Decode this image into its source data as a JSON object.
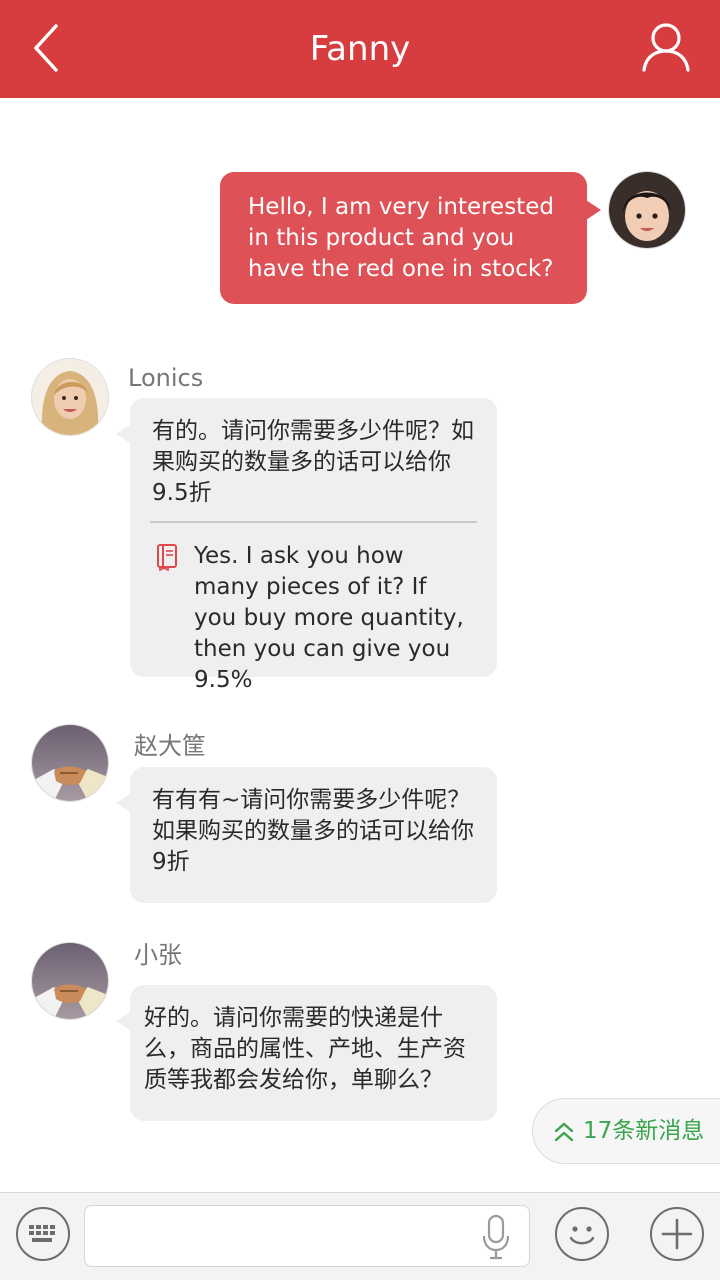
{
  "header": {
    "title": "Fanny",
    "back_icon": "back-arrow-icon",
    "user_icon": "user-profile-icon",
    "bg_color": "#d73c3f"
  },
  "messages": [
    {
      "direction": "outgoing",
      "text": "Hello, I am very interested in this product and you have the red one in stock?"
    },
    {
      "direction": "incoming",
      "sender": "Lonics",
      "text": "有的。请问你需要多少件呢？如果购买的数量多的话可以给你9.5折",
      "translation": "Yes. I ask you how many pieces of it? If you buy more quantity, then you can give you 9.5%",
      "translation_icon": "book-icon"
    },
    {
      "direction": "incoming",
      "sender": "赵大筐",
      "text": "有有有~请问你需要多少件呢？如果购买的数量多的话可以给你9折"
    },
    {
      "direction": "incoming",
      "sender": "小张",
      "text": "好的。请问你需要的快递是什么，商品的属性、产地、生产资质等我都会发给你，单聊么？"
    }
  ],
  "new_messages": {
    "label": "17条新消息",
    "icon": "double-chevron-up-icon",
    "color": "#3aa64b"
  },
  "toolbar": {
    "keyboard_icon": "keyboard-icon",
    "mic_icon": "microphone-icon",
    "emoji_icon": "smiley-icon",
    "add_icon": "plus-icon",
    "input_value": ""
  },
  "colors": {
    "outgoing_bubble": "#de5257",
    "incoming_bubble": "#efefef"
  }
}
